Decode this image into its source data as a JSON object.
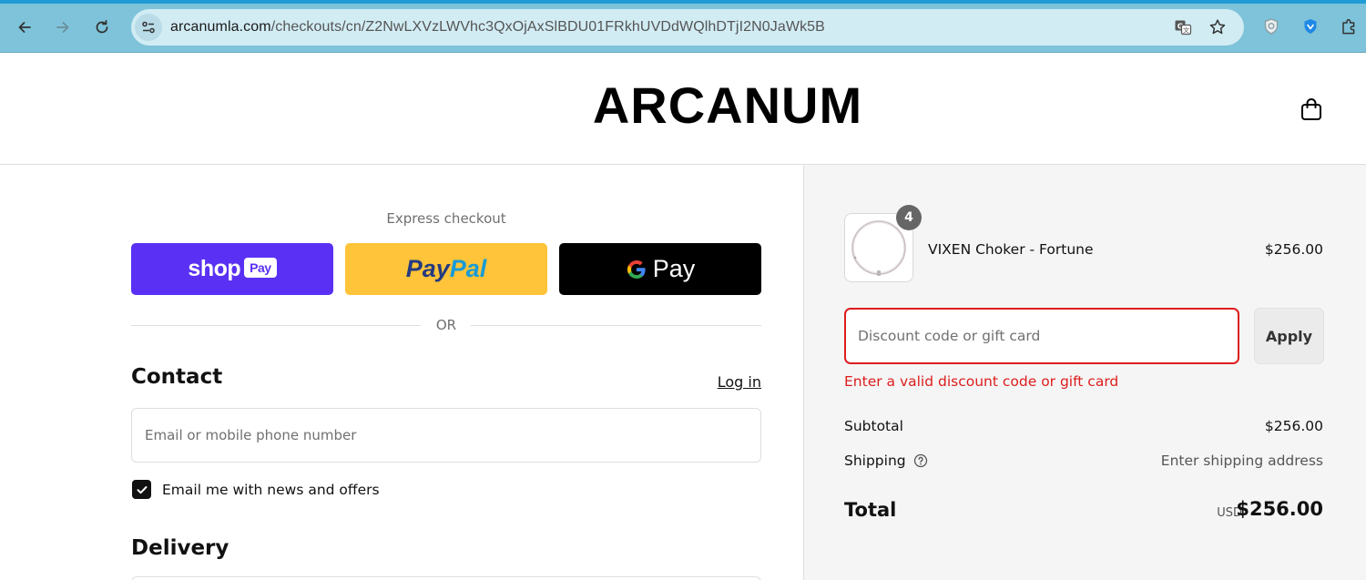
{
  "browser": {
    "url_host": "arcanumla.com",
    "url_path": "/checkouts/cn/Z2NwLXVzLWVhc3QxOjAxSlBDU01FRkhUVDdWQlhDTjI2N0JaWk5B",
    "icons": [
      "back-icon",
      "forward-icon",
      "reload-icon",
      "site-info-icon",
      "translate-icon",
      "bookmark-star-icon",
      "shield-extension-icon",
      "vpn-extension-icon",
      "extensions-puzzle-icon"
    ]
  },
  "store": {
    "logo": "ARCANUM",
    "cart_icon": "shopping-bag-icon"
  },
  "checkout": {
    "express_title": "Express checkout",
    "shoppay": {
      "brand": "shop",
      "pill": "Pay",
      "color": "#5a31f4"
    },
    "paypal": {
      "part1": "Pay",
      "part2": "Pal",
      "color": "#ffc439"
    },
    "gpay": {
      "label": "Pay",
      "color": "#000000"
    },
    "or_text": "OR",
    "contact": {
      "title": "Contact",
      "login_link": "Log in",
      "email_placeholder": "Email or mobile phone number",
      "email_value": "",
      "newsletter_label": "Email me with news and offers",
      "newsletter_checked": true
    },
    "delivery_title": "Delivery"
  },
  "summary": {
    "item": {
      "name": "VIXEN Choker - Fortune",
      "price": "$256.00",
      "quantity": "4"
    },
    "discount": {
      "placeholder": "Discount code or gift card",
      "value": "",
      "apply_label": "Apply",
      "error": "Enter a valid discount code or gift card",
      "error_color": "#dd1d1d"
    },
    "subtotal_label": "Subtotal",
    "subtotal_value": "$256.00",
    "shipping_label": "Shipping",
    "shipping_value": "Enter shipping address",
    "total_label": "Total",
    "total_currency": "USD",
    "total_value": "$256.00"
  }
}
